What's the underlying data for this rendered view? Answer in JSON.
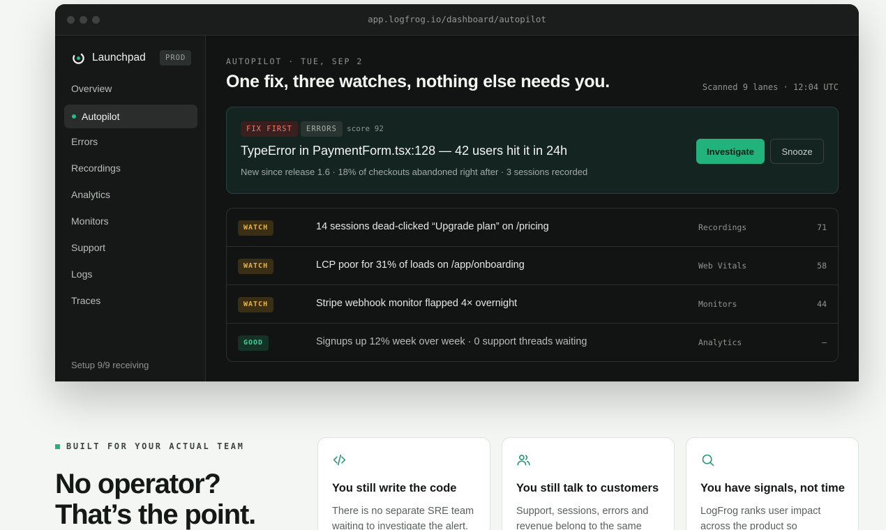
{
  "window": {
    "url": "app.logfrog.io/dashboard/autopilot"
  },
  "sidebar": {
    "brand": "Launchpad",
    "env": "PROD",
    "items": [
      {
        "label": "Overview"
      },
      {
        "label": "Autopilot",
        "active": true
      },
      {
        "label": "Errors"
      },
      {
        "label": "Recordings"
      },
      {
        "label": "Analytics"
      },
      {
        "label": "Monitors"
      },
      {
        "label": "Support"
      },
      {
        "label": "Logs"
      },
      {
        "label": "Traces"
      }
    ],
    "setup": "Setup 9/9 receiving"
  },
  "main": {
    "eyebrow": "AUTOPILOT · TUE, SEP 2",
    "headline": "One fix, three watches, nothing else needs you.",
    "scanned": "Scanned 9 lanes · 12:04 UTC",
    "fix": {
      "tag": "FIX FIRST",
      "category": "ERRORS",
      "score": "score 92",
      "title": "TypeError in PaymentForm.tsx:128 — 42 users hit it in 24h",
      "subtitle": "New since release 1.6 · 18% of checkouts abandoned right after · 3 sessions recorded",
      "investigate_label": "Investigate",
      "snooze_label": "Snooze"
    },
    "rows": [
      {
        "tag": "WATCH",
        "text": "14 sessions dead-clicked “Upgrade plan” on /pricing",
        "source": "Recordings",
        "score": "71"
      },
      {
        "tag": "WATCH",
        "text": "LCP poor for 31% of loads on /app/onboarding",
        "source": "Web Vitals",
        "score": "58"
      },
      {
        "tag": "WATCH",
        "text": "Stripe webhook monitor flapped 4× overnight",
        "source": "Monitors",
        "score": "44"
      },
      {
        "tag": "GOOD",
        "text": "Signups up 12% week over week · 0 support threads waiting",
        "source": "Analytics",
        "score": "—"
      }
    ]
  },
  "section": {
    "eyebrow": "BUILT FOR YOUR ACTUAL TEAM",
    "title_line1": "No operator?",
    "title_line2": "That’s the point.",
    "cards": [
      {
        "icon": "code-icon",
        "title": "You still write the code",
        "body": "There is no separate SRE team waiting to investigate the alert."
      },
      {
        "icon": "users-icon",
        "title": "You still talk to customers",
        "body": "Support, sessions, errors and revenue belong to the same"
      },
      {
        "icon": "search-icon",
        "title": "You have signals, not time",
        "body": "LogFrog ranks user impact across the product so"
      }
    ]
  },
  "colors": {
    "accent": "#22b37d",
    "fix_tag": "#f07a6e",
    "watch_tag": "#e6b34a",
    "good_tag": "#3fd099"
  }
}
